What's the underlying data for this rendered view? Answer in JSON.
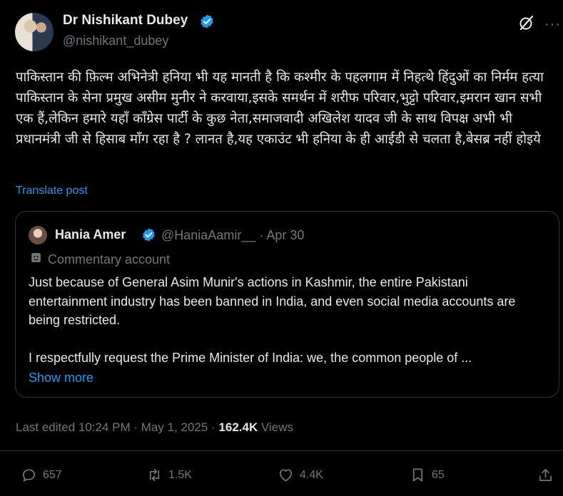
{
  "author": {
    "name": "Dr Nishikant Dubey",
    "handle": "@nishikant_dubey"
  },
  "post": {
    "text": "पाकिस्तान की फ़िल्म अभिनेत्री हनिया भी यह मानती है कि कश्मीर के पहलगाम में निहत्थे हिंदुओं का निर्मम हत्या पाकिस्तान के सेना प्रमुख असीम मुनीर ने करवाया,इसके समर्थन में शरीफ परिवार,भुट्टो परिवार,इमरान खान सभी एक हैं,लेकिन हमारे यहाँ कॉंग्रेस पार्टी के कुछ नेता,समाजवादी अखिलेश यादव जी के साथ विपक्ष अभी भी प्रधानमंत्री जी से हिसाब माँग रहा है ? लानत है,यह एकाउंट भी हनिया के ही आईडी से चलता है,बेसब्र नहीं होइये",
    "translate_label": "Translate post"
  },
  "quote": {
    "name": "Hania Amer",
    "handle_date": "@HaniaAamir__ · Apr 30",
    "badge": "Commentary account",
    "paragraph1": "Just because of General Asim Munir's actions in Kashmir, the entire Pakistani entertainment industry has been banned in India, and even social media accounts are being restricted.",
    "paragraph2": "I respectfully request the Prime Minister of India: we, the common people of ...",
    "show_more": "Show more"
  },
  "meta": {
    "edited": "Last edited 10:24 PM · May 1, 2025 · ",
    "views_count": "162.4K",
    "views_label": " Views"
  },
  "actions": {
    "replies": "657",
    "reposts": "1.5K",
    "likes": "4.4K",
    "bookmarks": "65"
  },
  "colors": {
    "background": "#000000",
    "text": "#e7e9ea",
    "muted": "#71767b",
    "accent": "#1d9bf0",
    "border": "#2f3336"
  }
}
